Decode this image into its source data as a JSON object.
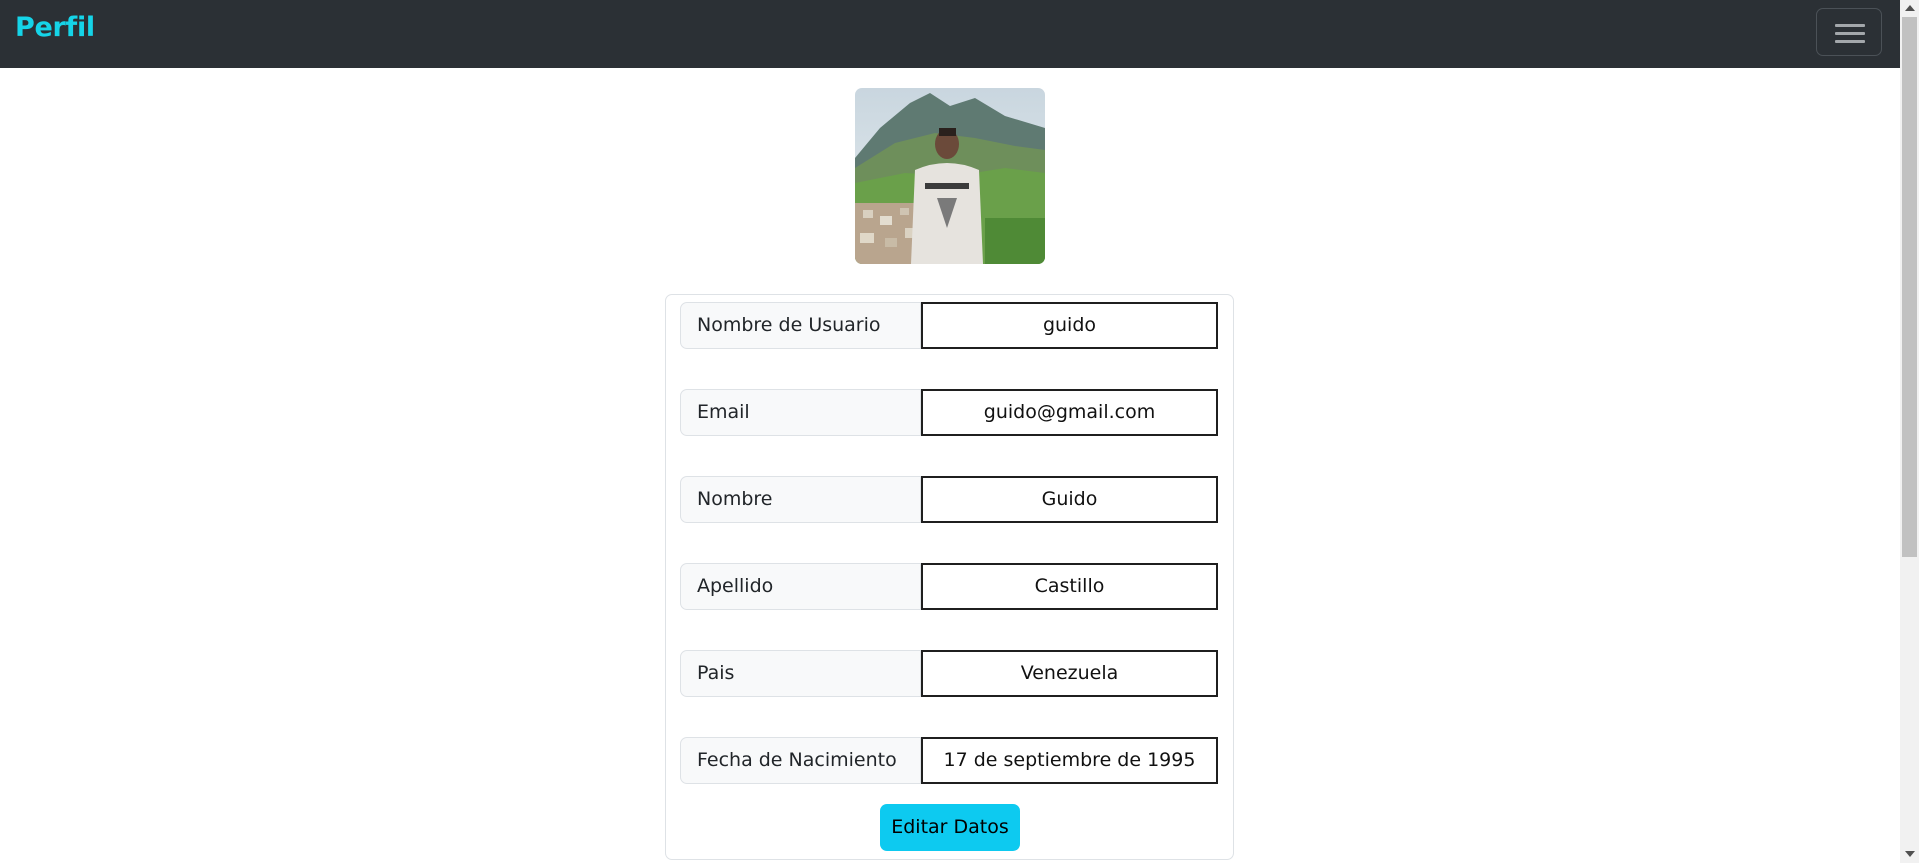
{
  "navbar": {
    "brand": "Perfil",
    "brand_color": "#15d4e8",
    "background": "#2b3035",
    "menu_icon": "hamburger-menu-icon"
  },
  "profile": {
    "avatar_alt": "Foto de perfil"
  },
  "fields": [
    {
      "label": "Nombre de Usuario",
      "value": "guido"
    },
    {
      "label": "Email",
      "value": "guido@gmail.com"
    },
    {
      "label": "Nombre",
      "value": "Guido"
    },
    {
      "label": "Apellido",
      "value": "Castillo"
    },
    {
      "label": "Pais",
      "value": "Venezuela"
    },
    {
      "label": "Fecha de Nacimiento",
      "value": "17 de septiembre de 1995"
    }
  ],
  "actions": {
    "edit_label": "Editar Datos",
    "edit_color": "#0dcaf0"
  }
}
